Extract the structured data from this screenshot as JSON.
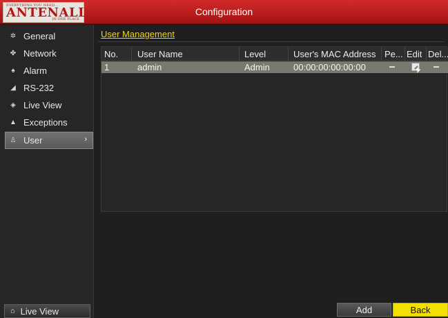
{
  "window": {
    "title": "Configuration"
  },
  "logo": {
    "top": "EVERYTHING YOU NEED...",
    "main": "ANTENALL",
    "sub": "IN ONE PLACE"
  },
  "sidebar": {
    "items": [
      {
        "label": "General",
        "icon": "gear-icon"
      },
      {
        "label": "Network",
        "icon": "network-icon"
      },
      {
        "label": "Alarm",
        "icon": "alarm-icon"
      },
      {
        "label": "RS-232",
        "icon": "serial-icon"
      },
      {
        "label": "Live View",
        "icon": "eye-icon"
      },
      {
        "label": "Exceptions",
        "icon": "warning-icon"
      },
      {
        "label": "User",
        "icon": "user-icon",
        "active": true
      }
    ],
    "live_view_button": "Live View"
  },
  "main": {
    "section_title": "User Management",
    "table": {
      "columns": [
        "No.",
        "User Name",
        "Level",
        "User's MAC Address",
        "Pe...",
        "Edit",
        "Del..."
      ],
      "rows": [
        {
          "no": "1",
          "user_name": "admin",
          "level": "Admin",
          "mac": "00:00:00:00:00:00"
        }
      ]
    },
    "buttons": {
      "add": "Add",
      "back": "Back"
    }
  },
  "colors": {
    "accent": "#f4e000",
    "titlebar": "#c42020",
    "selected_row": "#78786e"
  }
}
